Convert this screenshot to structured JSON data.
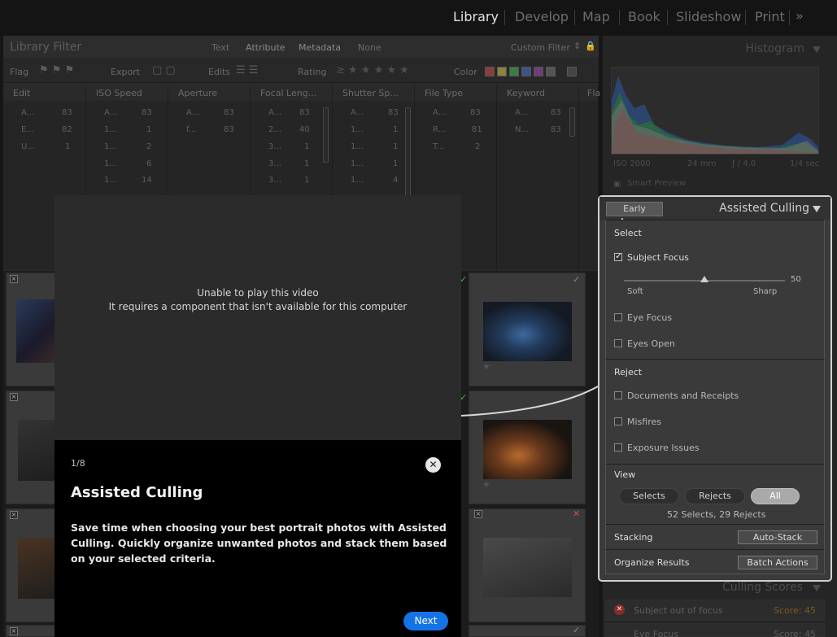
{
  "modules": {
    "items": [
      "Library",
      "Develop",
      "Map",
      "Book",
      "Slideshow",
      "Print"
    ],
    "active": "Library",
    "more_glyph": "»"
  },
  "library_filter": {
    "title": "Library Filter",
    "modes": [
      "Text",
      "Attribute",
      "Metadata",
      "None"
    ],
    "preset": "Custom Filter",
    "tools": {
      "flag": "Flag",
      "export": "Export",
      "edits": "Edits",
      "rating": "Rating",
      "color": "Color"
    },
    "colors": [
      "#8b3c3c",
      "#8a8440",
      "#3e7a44",
      "#3d5487",
      "#6b3f7a",
      "#555555",
      "#454545"
    ]
  },
  "metadata_columns": [
    {
      "header": "Edit",
      "rows": [
        [
          "A...",
          "83"
        ],
        [
          "E...",
          "82"
        ],
        [
          "U...",
          "1"
        ]
      ]
    },
    {
      "header": "ISO Speed",
      "rows": [
        [
          "A...",
          "83"
        ],
        [
          "1...",
          "1"
        ],
        [
          "1...",
          "2"
        ],
        [
          "1...",
          "6"
        ],
        [
          "1...",
          "14"
        ]
      ]
    },
    {
      "header": "Aperture",
      "rows": [
        [
          "A...",
          "83"
        ],
        [
          "f...",
          "83"
        ]
      ]
    },
    {
      "header": "Focal Leng...",
      "rows": [
        [
          "A...",
          "83"
        ],
        [
          "2...",
          "40"
        ],
        [
          "3...",
          "1"
        ],
        [
          "3...",
          "1"
        ],
        [
          "3...",
          "1"
        ]
      ]
    },
    {
      "header": "Shutter Sp...",
      "rows": [
        [
          "A...",
          "83"
        ],
        [
          "1...",
          "1"
        ],
        [
          "1...",
          "1"
        ],
        [
          "1...",
          "1"
        ],
        [
          "1...",
          "4"
        ]
      ]
    },
    {
      "header": "File Type",
      "rows": [
        [
          "A...",
          "83"
        ],
        [
          "R...",
          "81"
        ],
        [
          "T...",
          "2"
        ]
      ]
    },
    {
      "header": "Keyword",
      "rows": [
        [
          "A...",
          "83"
        ],
        [
          "N...",
          "83"
        ]
      ]
    },
    {
      "header": "Fla",
      "rows": []
    }
  ],
  "histogram": {
    "title": "Histogram",
    "iso": "ISO 2000",
    "focal": "24 mm",
    "aperture": "ƒ / 4.0",
    "shutter": "1/4 sec",
    "smart_preview": "Smart Preview"
  },
  "culling": {
    "badge": "Early Access",
    "title": "Assisted Culling",
    "select_label": "Select",
    "subject_focus": {
      "label": "Subject Focus",
      "checked": true,
      "value": "50",
      "min_label": "Soft",
      "max_label": "Sharp",
      "level": 0.5
    },
    "eye_focus": "Eye Focus",
    "eyes_open": "Eyes Open",
    "reject_label": "Reject",
    "reject_items": [
      "Documents and Receipts",
      "Misfires",
      "Exposure Issues"
    ],
    "view_label": "View",
    "view_options": [
      "Selects",
      "Rejects",
      "All"
    ],
    "view_active": "All",
    "summary": "52 Selects, 29 Rejects",
    "stacking_label": "Stacking",
    "auto_stack": "Auto-Stack",
    "organize_label": "Organize Results",
    "batch_actions": "Batch Actions"
  },
  "culling_scores": {
    "title": "Culling Scores",
    "rows": [
      {
        "label": "Subject out of focus",
        "score": "Score: 45"
      },
      {
        "label": "Eye Focus",
        "score": "Score: 45"
      }
    ]
  },
  "video": {
    "line1": "Unable to play this video",
    "line2": "It requires a component that isn't available for this computer"
  },
  "tour": {
    "step": "1/8",
    "title": "Assisted Culling",
    "body": "Save time when choosing your best portrait photos with Assisted Culling. Quickly organize unwanted photos and stack them based on your selected criteria.",
    "next": "Next",
    "close_glyph": "✕"
  }
}
